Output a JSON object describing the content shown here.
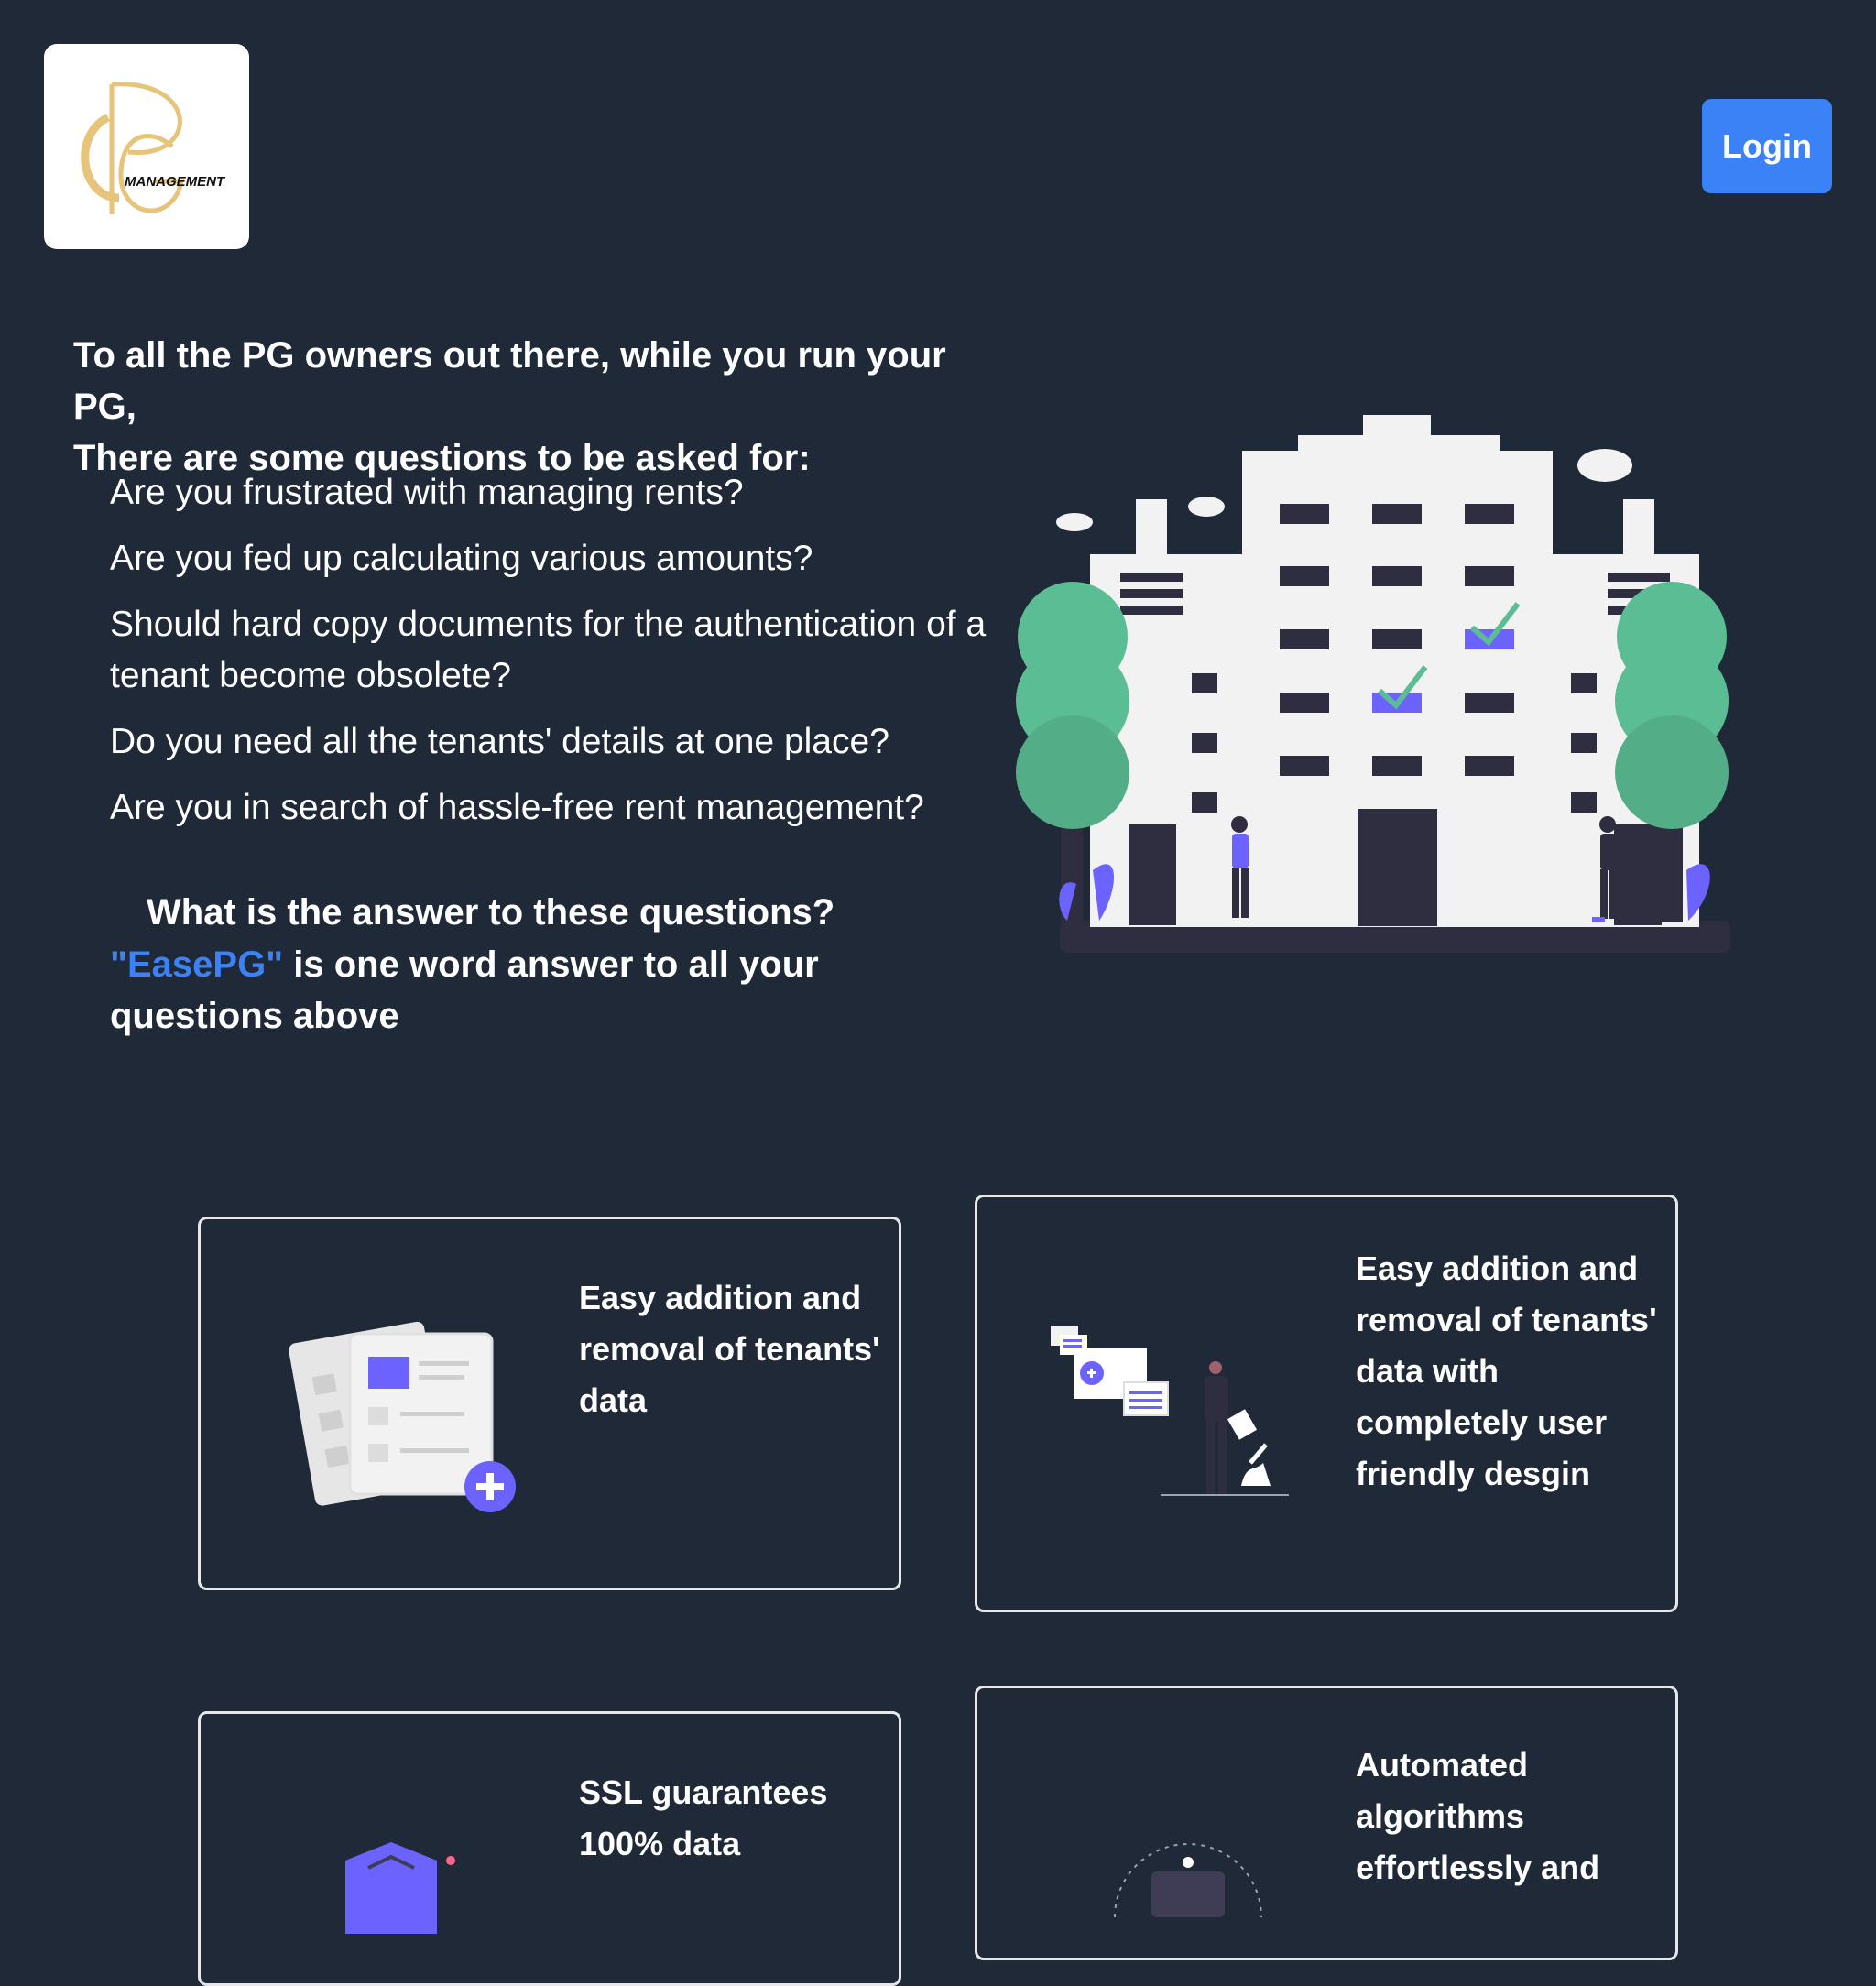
{
  "header": {
    "logo_text": "MANAGEMENT",
    "login_label": "Login"
  },
  "intro": {
    "heading_line1": "To all the PG owners out there, while you run your PG,",
    "heading_line2": "There are some questions to be asked for:",
    "questions": [
      "Are you frustrated with managing rents?",
      "Are you fed up calculating various amounts?",
      "Should hard copy documents for the authentication of a tenant become obsolete?",
      "Do you need all the tenants' details at one place?",
      "Are you in search of hassle-free rent management?"
    ],
    "answer_question": "What is the answer to these questions?",
    "brand_name": "\"EasePG\"",
    "answer_rest": " is one word answer to all your questions above"
  },
  "features": [
    {
      "text": "Easy addition and removal of tenants' data",
      "icon": "documents-add-icon"
    },
    {
      "text": "Easy addition and removal of tenants' data with completely user friendly desgin",
      "icon": "person-files-icon"
    },
    {
      "text": "SSL guarantees 100% data",
      "icon": "shield-icon"
    },
    {
      "text": "Automated algorithms effortlessly and",
      "icon": "automation-icon"
    }
  ],
  "colors": {
    "background": "#1f2937",
    "accent": "#3b82f6",
    "logo_gold": "#e8c37a",
    "illustration_purple": "#6c63ff",
    "tree_green": "#5bbd94"
  }
}
